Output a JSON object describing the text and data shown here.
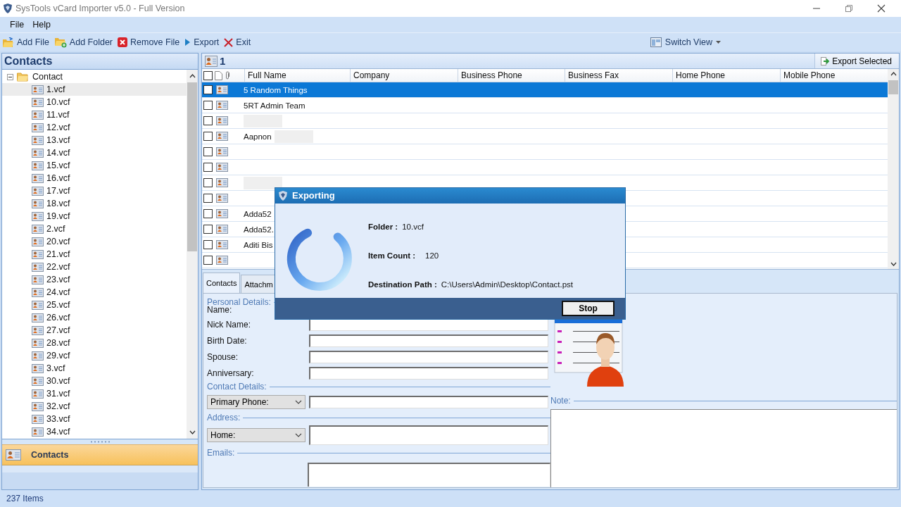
{
  "window": {
    "title": "SysTools vCard Importer v5.0 - Full Version"
  },
  "menu": [
    "File",
    "Help"
  ],
  "toolbar": [
    {
      "label": "Add File",
      "kind": "add-file"
    },
    {
      "label": "Add Folder",
      "kind": "add-folder"
    },
    {
      "label": "Remove File",
      "kind": "remove"
    },
    {
      "label": "Export",
      "kind": "export"
    },
    {
      "label": "Exit",
      "kind": "exit"
    }
  ],
  "switch_view": "Switch View",
  "sidebar": {
    "title": "Contacts",
    "tree": {
      "label": "Contact",
      "expanded": true,
      "children": [
        {
          "label": "1.vcf",
          "selected": true
        },
        {
          "label": "10.vcf",
          "selected": false
        },
        {
          "label": "11.vcf",
          "selected": false
        },
        {
          "label": "12.vcf",
          "selected": false
        },
        {
          "label": "13.vcf",
          "selected": false
        },
        {
          "label": "14.vcf",
          "selected": false
        },
        {
          "label": "15.vcf",
          "selected": false
        },
        {
          "label": "16.vcf",
          "selected": false
        },
        {
          "label": "17.vcf",
          "selected": false
        },
        {
          "label": "18.vcf",
          "selected": false
        },
        {
          "label": "19.vcf",
          "selected": false
        },
        {
          "label": "2.vcf",
          "selected": false
        },
        {
          "label": "20.vcf",
          "selected": false
        },
        {
          "label": "21.vcf",
          "selected": false
        },
        {
          "label": "22.vcf",
          "selected": false
        },
        {
          "label": "23.vcf",
          "selected": false
        },
        {
          "label": "24.vcf",
          "selected": false
        },
        {
          "label": "25.vcf",
          "selected": false
        },
        {
          "label": "26.vcf",
          "selected": false
        },
        {
          "label": "27.vcf",
          "selected": false
        },
        {
          "label": "28.vcf",
          "selected": false
        },
        {
          "label": "29.vcf",
          "selected": false
        },
        {
          "label": "3.vcf",
          "selected": false
        },
        {
          "label": "30.vcf",
          "selected": false
        },
        {
          "label": "31.vcf",
          "selected": false
        },
        {
          "label": "32.vcf",
          "selected": false
        },
        {
          "label": "33.vcf",
          "selected": false
        },
        {
          "label": "34.vcf",
          "selected": false
        }
      ]
    },
    "nav_button": "Contacts"
  },
  "list_header": {
    "count": "1",
    "export_button": "Export Selected"
  },
  "table": {
    "select_all_checked": false,
    "columns": [
      "Full Name",
      "Company",
      "Business Phone",
      "Business Fax",
      "Home Phone",
      "Mobile Phone"
    ],
    "rows": [
      {
        "name": "5 Random Things",
        "selected": true,
        "checked": false,
        "redacted": false
      },
      {
        "name": "5RT Admin Team",
        "selected": false,
        "checked": false,
        "redacted": false
      },
      {
        "name": "",
        "selected": false,
        "checked": false,
        "redacted": true
      },
      {
        "name": "Aapnon",
        "selected": false,
        "checked": false,
        "redacted": true
      },
      {
        "name": "",
        "selected": false,
        "checked": false,
        "redacted": false
      },
      {
        "name": "",
        "selected": false,
        "checked": false,
        "redacted": false
      },
      {
        "name": "",
        "selected": false,
        "checked": false,
        "redacted": true
      },
      {
        "name": "",
        "selected": false,
        "checked": false,
        "redacted": false
      },
      {
        "name": "Adda52",
        "selected": false,
        "checked": false,
        "redacted": false
      },
      {
        "name": "Adda52.",
        "selected": false,
        "checked": false,
        "redacted": false
      },
      {
        "name": "Aditi Bis",
        "selected": false,
        "checked": false,
        "redacted": false
      },
      {
        "name": "",
        "selected": false,
        "checked": false,
        "redacted": false
      }
    ]
  },
  "details": {
    "tabs": [
      {
        "label": "Contacts",
        "selected": true
      },
      {
        "label": "Attachm",
        "selected": false
      }
    ],
    "personal_legend": "Personal Details:",
    "personal_fields": [
      {
        "label": "Name:",
        "kind": "label"
      },
      {
        "label": "Nick Name:",
        "kind": "text"
      },
      {
        "label": "Birth Date:",
        "kind": "text"
      },
      {
        "label": "Spouse:",
        "kind": "text"
      },
      {
        "label": "Anniversary:",
        "kind": "text"
      }
    ],
    "contact_legend": "Contact Details:",
    "phone_dropdown": "Primary Phone:",
    "address_legend": "Address:",
    "address_dropdown": "Home:",
    "emails_legend": "Emails:",
    "note_legend": "Note:"
  },
  "dialog": {
    "title": "Exporting",
    "fields": [
      {
        "label": "Folder :",
        "value": "10.vcf"
      },
      {
        "label": "Item Count :",
        "value": "120"
      },
      {
        "label": "Destination Path :",
        "value": "C:\\Users\\Admin\\Desktop\\Contact.pst"
      }
    ],
    "button": "Stop"
  },
  "status_bar": "237 Items"
}
